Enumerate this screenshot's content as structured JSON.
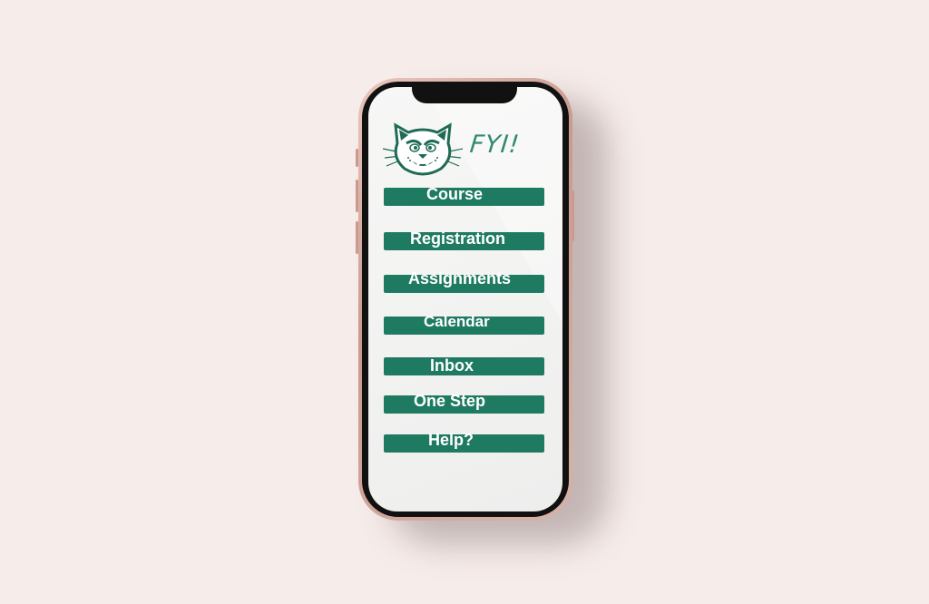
{
  "app": {
    "title": "FYI!",
    "logo_icon": "wildcat-mascot-icon",
    "accent_color": "#1f7a62",
    "background_color": "#f6ecea"
  },
  "menu": {
    "items": [
      {
        "label": "Course"
      },
      {
        "label": "Registration"
      },
      {
        "label": "Assignments"
      },
      {
        "label": "Calendar"
      },
      {
        "label": "Inbox"
      },
      {
        "label": "One Step"
      },
      {
        "label": "Help?"
      }
    ]
  }
}
